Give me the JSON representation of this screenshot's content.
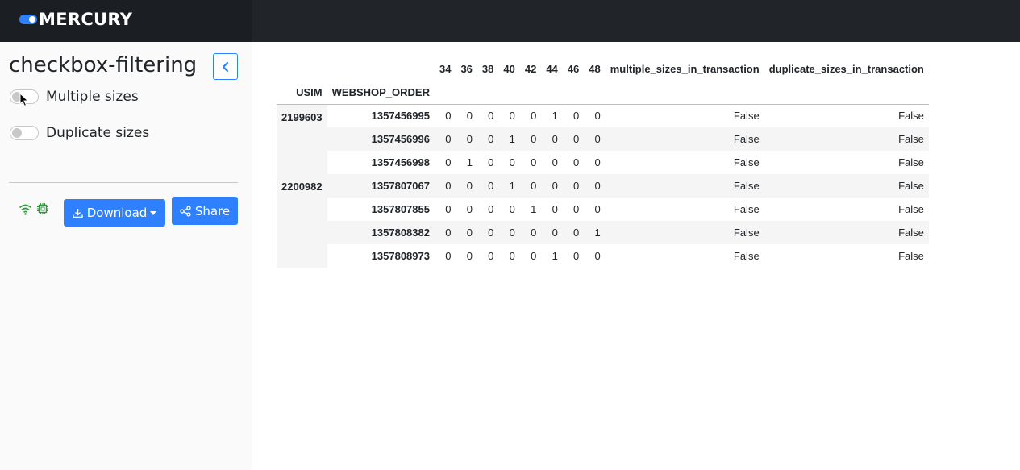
{
  "brand": {
    "name": "MERCURY",
    "accent": "#2f80ff"
  },
  "sidebar": {
    "title": "checkbox-filtering",
    "collapse_icon": "chevron-left-icon",
    "switches": [
      {
        "label": "Multiple sizes",
        "checked": false
      },
      {
        "label": "Duplicate sizes",
        "checked": false
      }
    ],
    "status_icons": [
      "wifi-icon",
      "cpu-chip-icon"
    ],
    "download_label": "Download",
    "share_label": "Share"
  },
  "table": {
    "columns": [
      "34",
      "36",
      "38",
      "40",
      "42",
      "44",
      "46",
      "48",
      "multiple_sizes_in_transaction",
      "duplicate_sizes_in_transaction"
    ],
    "index_names": [
      "USIM",
      "WEBSHOP_ORDER"
    ],
    "rows": [
      {
        "usim": "2199603",
        "order": "1357456995",
        "values": [
          "0",
          "0",
          "0",
          "0",
          "0",
          "1",
          "0",
          "0",
          "False",
          "False"
        ]
      },
      {
        "usim": "",
        "order": "1357456996",
        "values": [
          "0",
          "0",
          "0",
          "1",
          "0",
          "0",
          "0",
          "0",
          "False",
          "False"
        ]
      },
      {
        "usim": "",
        "order": "1357456998",
        "values": [
          "0",
          "1",
          "0",
          "0",
          "0",
          "0",
          "0",
          "0",
          "False",
          "False"
        ]
      },
      {
        "usim": "2200982",
        "order": "1357807067",
        "values": [
          "0",
          "0",
          "0",
          "1",
          "0",
          "0",
          "0",
          "0",
          "False",
          "False"
        ]
      },
      {
        "usim": "",
        "order": "1357807855",
        "values": [
          "0",
          "0",
          "0",
          "0",
          "1",
          "0",
          "0",
          "0",
          "False",
          "False"
        ]
      },
      {
        "usim": "",
        "order": "1357808382",
        "values": [
          "0",
          "0",
          "0",
          "0",
          "0",
          "0",
          "0",
          "1",
          "False",
          "False"
        ]
      },
      {
        "usim": "",
        "order": "1357808973",
        "values": [
          "0",
          "0",
          "0",
          "0",
          "0",
          "1",
          "0",
          "0",
          "False",
          "False"
        ]
      }
    ]
  }
}
